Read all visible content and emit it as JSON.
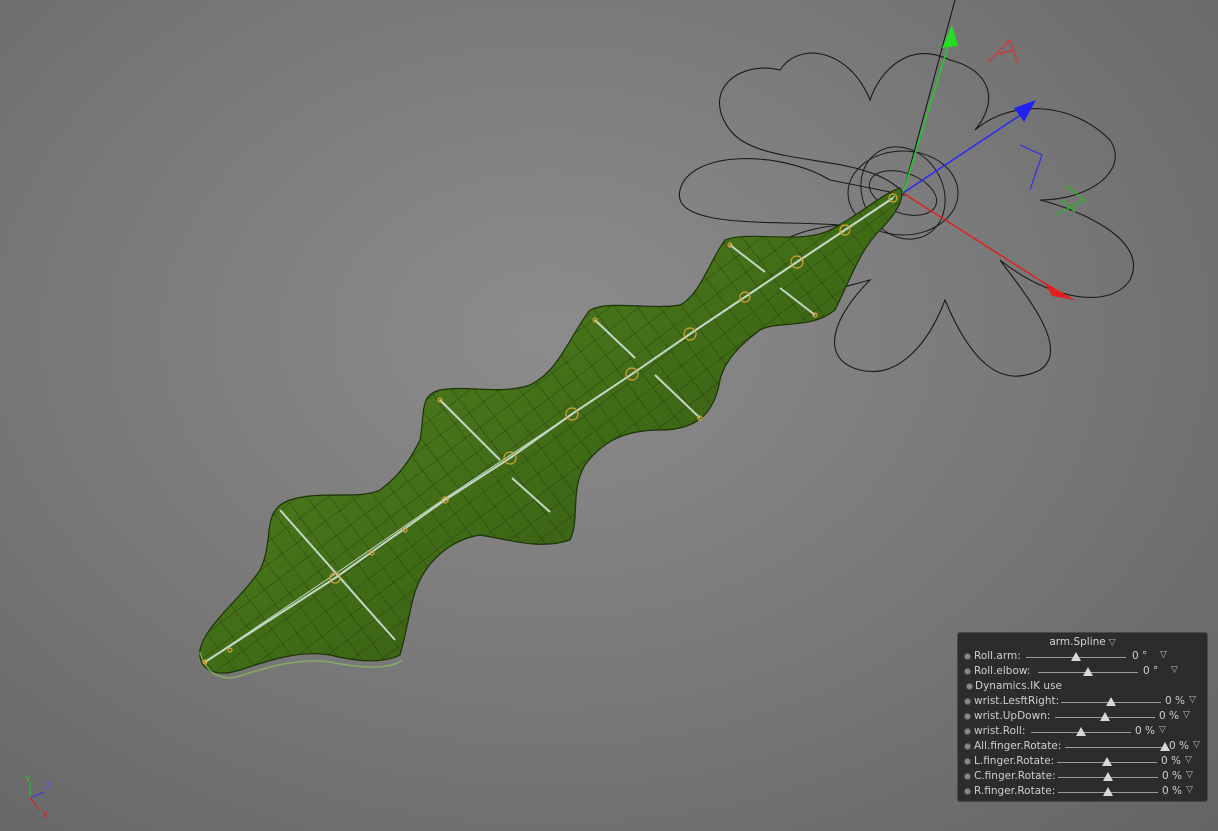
{
  "viewport": {
    "colors": {
      "mesh": "#4a7a1e",
      "mesh_dark": "#2e4f10",
      "wire": "#1f3608",
      "bone": "#cfe0d6",
      "joint": "#d9a23a"
    },
    "axis_gizmo": {
      "x_label": "X",
      "y_label": "Y",
      "z_label": "Z"
    }
  },
  "panel": {
    "title": "arm.Spline",
    "title_arrow": "▽",
    "rows": [
      {
        "label": "Roll.arm:",
        "value": "0 °",
        "level": 0.5,
        "arrow": "▽"
      },
      {
        "label": "Roll.elbow:",
        "value": "0 °",
        "level": 0.5,
        "arrow": "▽"
      },
      {
        "label": "Dynamics.IK use",
        "value": "",
        "level": null,
        "arrow": ""
      },
      {
        "label": "wrist.LesftRight:",
        "value": "0 %",
        "level": 0.5,
        "arrow": "▽"
      },
      {
        "label": "wrist.UpDown:",
        "value": "0 %",
        "level": 0.5,
        "arrow": "▽"
      },
      {
        "label": "wrist.Roll:",
        "value": "0 %",
        "level": 0.5,
        "arrow": "▽"
      },
      {
        "label": "All.finger.Rotate:",
        "value": "0 %",
        "level": 1.0,
        "arrow": "▽"
      },
      {
        "label": "L.finger.Rotate:",
        "value": "0 %",
        "level": 0.5,
        "arrow": "▽"
      },
      {
        "label": "C.finger.Rotate:",
        "value": "0 %",
        "level": 0.5,
        "arrow": "▽"
      },
      {
        "label": "R.finger.Rotate:",
        "value": "0 %",
        "level": 0.5,
        "arrow": "▽"
      }
    ]
  }
}
